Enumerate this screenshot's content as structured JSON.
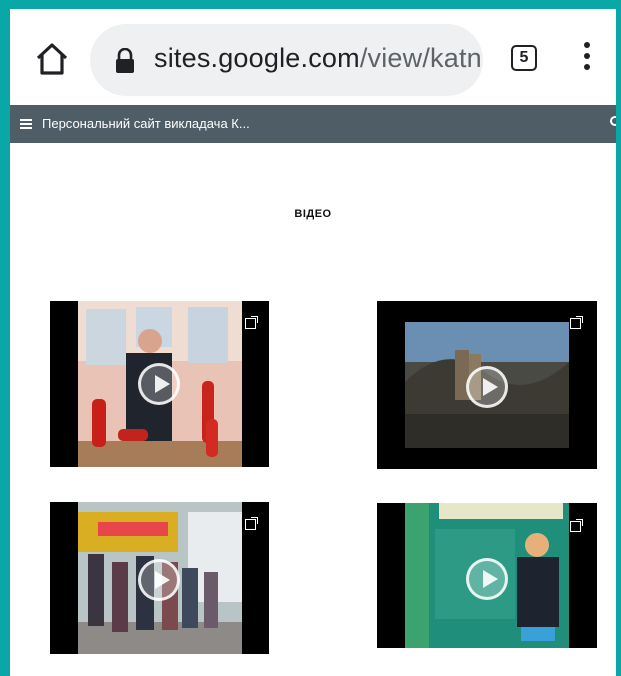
{
  "browser": {
    "url_host": "sites.google.com",
    "url_path": "/view/katn",
    "tab_count": "5",
    "icons": {
      "home": "home-icon",
      "lock": "lock-icon",
      "menu": "more-vert-icon"
    }
  },
  "site": {
    "title": "Персональний сайт викладача К...",
    "header_color": "#4f5d67"
  },
  "section": {
    "title": "ВІДЕО"
  },
  "videos": [
    {
      "id": "video-1",
      "icon": "play-icon"
    },
    {
      "id": "video-2",
      "icon": "play-icon"
    },
    {
      "id": "video-3",
      "icon": "play-icon"
    },
    {
      "id": "video-4",
      "icon": "play-icon"
    }
  ],
  "colors": {
    "border": "#0aa7a7",
    "urlbar": "#eef0f2"
  }
}
